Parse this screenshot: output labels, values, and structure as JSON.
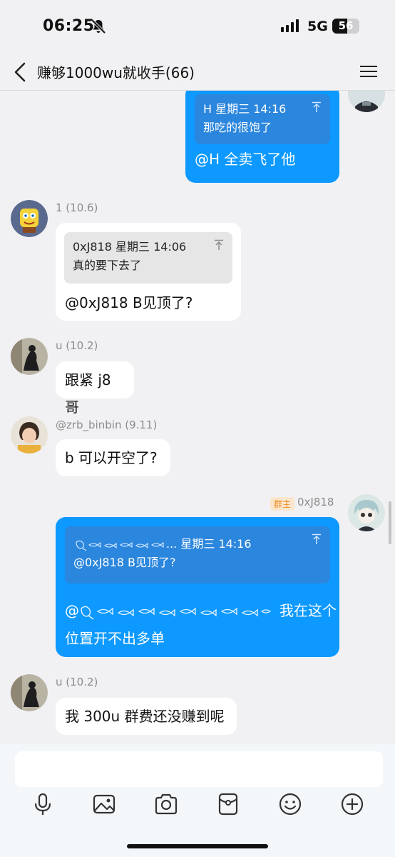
{
  "status": {
    "time": "06:25",
    "network": "5G",
    "battery": "56",
    "battery_level": 0.56
  },
  "header": {
    "title": "赚够1000wu就收手(66)"
  },
  "messages": [
    {
      "id": "m1",
      "quote": {
        "author_time": "H 星期三 14:16",
        "text": "那吃的很饱了"
      },
      "text": "@H 全卖飞了他"
    },
    {
      "id": "m2",
      "sender": "1 (10.6)",
      "quote": {
        "author_time": "0xJ818 星期三 14:06",
        "text": "真的要下去了"
      },
      "text": "@0xJ818 B见顶了?"
    },
    {
      "id": "m3",
      "sender": "u (10.2)",
      "text": "跟紧 j8 哥"
    },
    {
      "id": "m4",
      "sender": "@zrb_binbin (9.11)",
      "text": "b 可以开空了?"
    },
    {
      "id": "m5",
      "badge": "群主",
      "sender": "0xJ818",
      "quote": {
        "author_suffix": "... 星期三 14:16",
        "text": "@0xJ818 B见顶了?"
      },
      "text_prefix": "@",
      "text_after": "我在这个",
      "text_line2": "位置开不出多单"
    },
    {
      "id": "m6",
      "sender": "u (10.2)",
      "text": "我 300u 群费还没赚到呢"
    }
  ],
  "input": {
    "placeholder": ""
  },
  "toolbar": {
    "icons": [
      "microphone-icon",
      "image-icon",
      "camera-icon",
      "red-packet-icon",
      "emoji-icon",
      "plus-icon"
    ]
  },
  "colors": {
    "outgoing_bubble": "#0d99ff",
    "incoming_bubble": "#ffffff",
    "background": "#f1f1f3",
    "owner_badge_text": "#ef8b21",
    "owner_badge_bg": "#fbe6cd"
  }
}
